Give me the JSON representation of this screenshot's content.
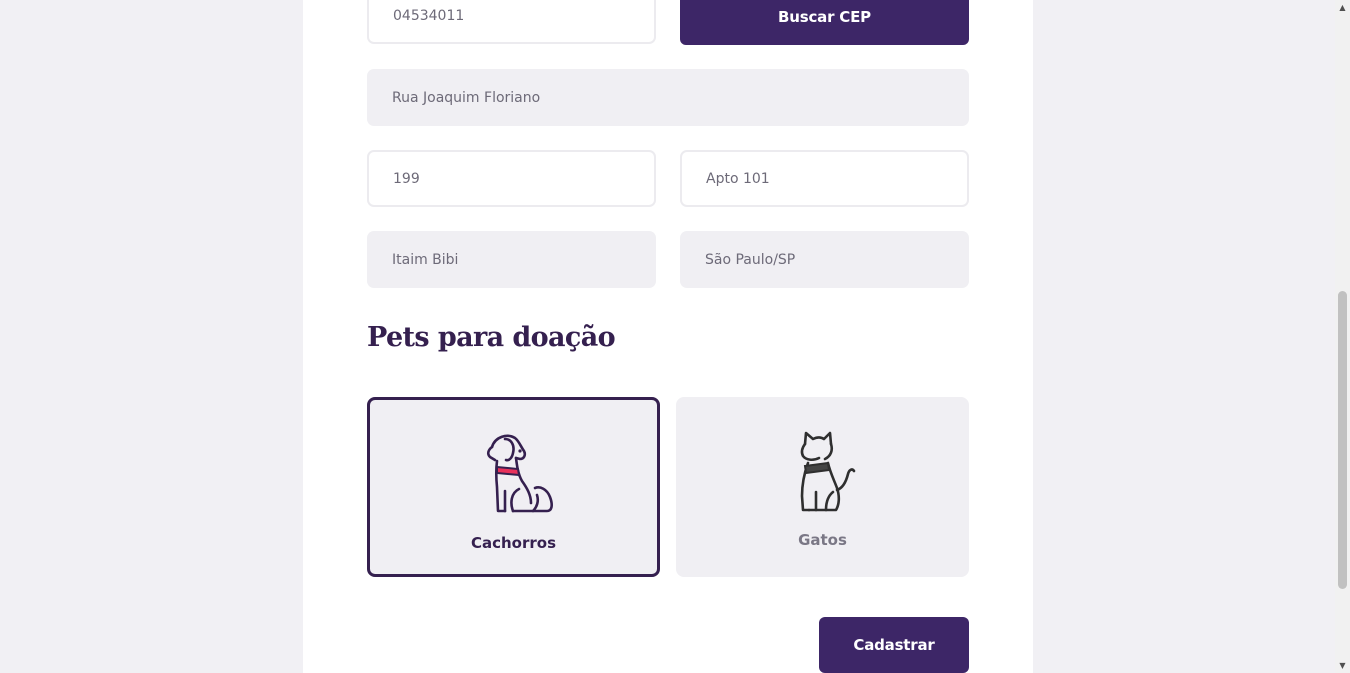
{
  "form": {
    "cep_value": "04534011",
    "buscar_cep_label": "Buscar CEP",
    "street_value": "Rua Joaquim Floriano",
    "number_value": "199",
    "complement_value": "Apto 101",
    "neighborhood_value": "Itaim Bibi",
    "city_value": "São Paulo/SP"
  },
  "pets": {
    "title": "Pets para doação",
    "options": [
      {
        "label": "Cachorros",
        "icon": "dog-icon",
        "selected": true
      },
      {
        "label": "Gatos",
        "icon": "cat-icon",
        "selected": false
      }
    ]
  },
  "submit_label": "Cadastrar",
  "colors": {
    "primary": "#3d2667",
    "title": "#35204f",
    "field_bg": "#f0eff3",
    "dog_collar": "#e8315b",
    "cat_collar": "#444444"
  }
}
